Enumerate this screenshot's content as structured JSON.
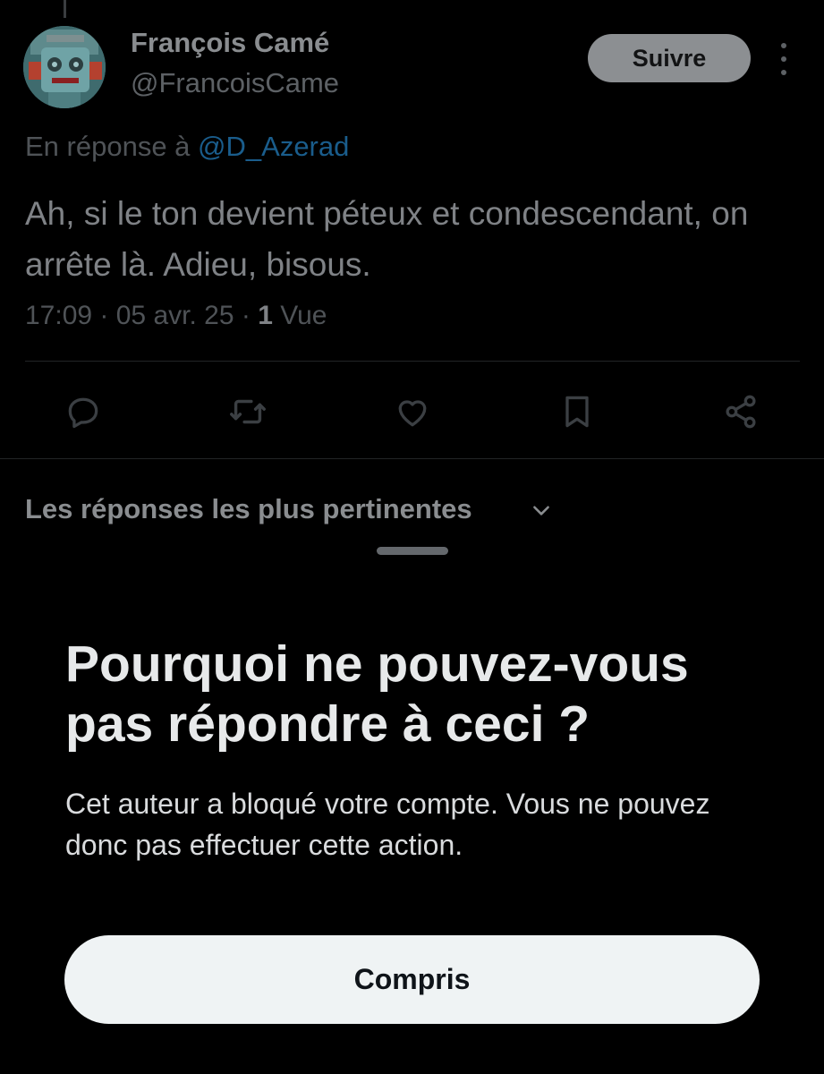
{
  "tweet": {
    "author_name": "François Camé",
    "author_handle": "@FrancoisCame",
    "follow_label": "Suivre",
    "reply_to_prefix": "En réponse à",
    "reply_to_handle": "@D_Azerad",
    "text": "Ah, si le ton devient péteux et condescendant, on arrête là. Adieu, bisous.",
    "time": "17:09",
    "date": "05 avr. 25",
    "views_count": "1",
    "views_label": "Vue",
    "actions": [
      "reply-icon",
      "retweet-icon",
      "like-icon",
      "bookmark-icon",
      "share-icon"
    ]
  },
  "replies": {
    "sort_label": "Les réponses les plus pertinentes"
  },
  "sheet": {
    "title": "Pourquoi ne pouvez-vous pas répondre à ceci ?",
    "body": "Cet auteur a bloqué votre compte. Vous ne pouvez donc pas effectuer cette action.",
    "confirm_label": "Compris"
  },
  "colors": {
    "background": "#000000",
    "mention": "#1D9BF0",
    "button_bg": "#EFF3F4"
  }
}
